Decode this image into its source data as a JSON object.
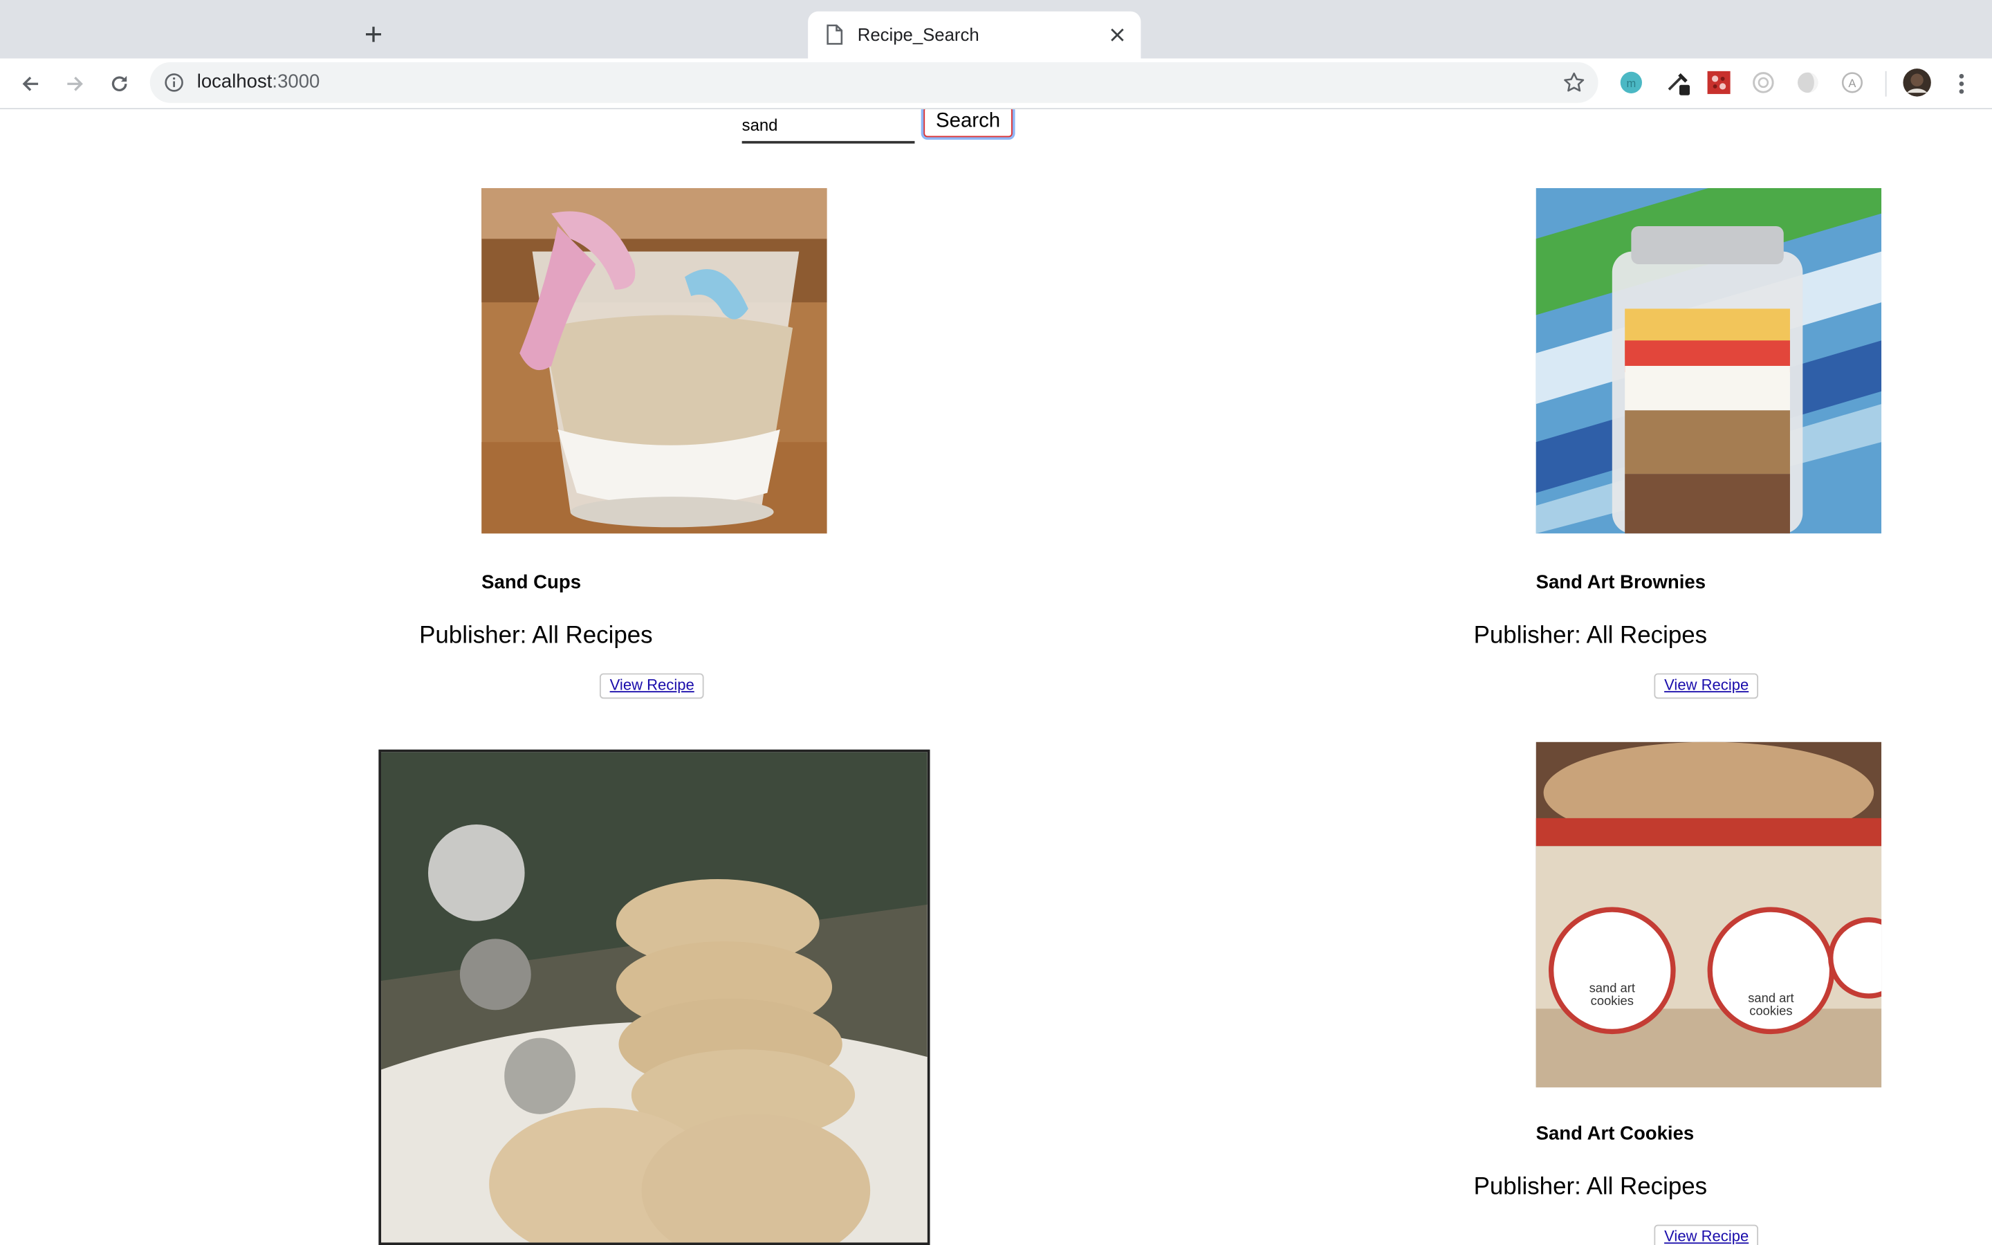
{
  "browser": {
    "new_tab_symbol": "+",
    "tab": {
      "title": "Recipe_Search",
      "icon": "document-icon"
    },
    "address": {
      "host": "localhost",
      "port": ":3000"
    },
    "extensions": [
      "teal-circle-extension-icon",
      "eyedropper-extension-icon",
      "red-puzzle-extension-icon",
      "grey-circle-extension-icon",
      "grey-moon-extension-icon",
      "grey-a-extension-icon"
    ]
  },
  "search": {
    "value": "sand",
    "button_label": "Search"
  },
  "recipes": [
    {
      "title": "Sand Cups",
      "publisher": "Publisher: All Recipes",
      "button": "View Recipe"
    },
    {
      "title": "Sand Art Brownies",
      "publisher": "Publisher: All Recipes",
      "button": "View Recipe"
    },
    {
      "title": "Sand Art Cookies",
      "publisher": "Publisher: All Recipes",
      "button": "View Recipe"
    }
  ],
  "image_labels": {
    "jar_tag_text": "sand art cookies"
  },
  "colors": {
    "link": "#1a0dab",
    "tab_strip": "#dee1e6",
    "omnibox": "#f1f3f4"
  }
}
